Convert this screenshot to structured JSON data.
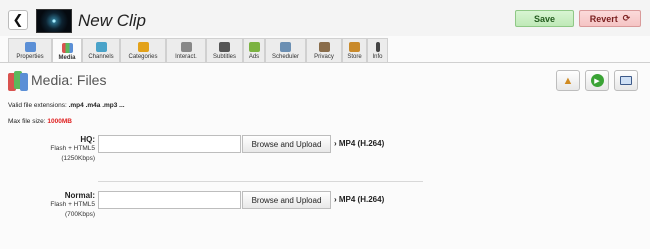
{
  "header": {
    "title": "New Clip",
    "save_label": "Save",
    "revert_label": "Revert"
  },
  "tabs": [
    {
      "label": "Properties",
      "icon": "properties-icon",
      "color": "#5b8fd6"
    },
    {
      "label": "Media",
      "icon": "media-icon",
      "color": "#d9534f"
    },
    {
      "label": "Channels",
      "icon": "channels-icon",
      "color": "#4aa3c9"
    },
    {
      "label": "Categories",
      "icon": "categories-icon",
      "color": "#e3a21a"
    },
    {
      "label": "Interact.",
      "icon": "interact-icon",
      "color": "#888888"
    },
    {
      "label": "Subtitles",
      "icon": "subtitles-icon",
      "color": "#555555"
    },
    {
      "label": "Ads",
      "icon": "ads-icon",
      "color": "#7cb342"
    },
    {
      "label": "Scheduler",
      "icon": "scheduler-icon",
      "color": "#6b8fb3"
    },
    {
      "label": "Privacy",
      "icon": "privacy-icon",
      "color": "#8a6d4b"
    },
    {
      "label": "Store",
      "icon": "store-icon",
      "color": "#c98a2b"
    },
    {
      "label": "Info",
      "icon": "info-icon",
      "color": "#444444"
    }
  ],
  "section": {
    "title": "Media: Files",
    "extensions_prefix": "Valid file extensions: ",
    "extensions": ".mp4 .m4a .mp3 ...",
    "max_size_prefix": "Max file size: ",
    "max_size": "1000MB"
  },
  "fields": [
    {
      "label": "HQ:",
      "sub1": "Flash + HTML5",
      "sub2": "(1250Kbps)",
      "button": "Browse and Upload",
      "format": "› MP4 (H.264)"
    },
    {
      "label": "Normal:",
      "sub1": "Flash + HTML5",
      "sub2": "(700Kbps)",
      "button": "Browse and Upload",
      "format": "› MP4 (H.264)"
    }
  ]
}
